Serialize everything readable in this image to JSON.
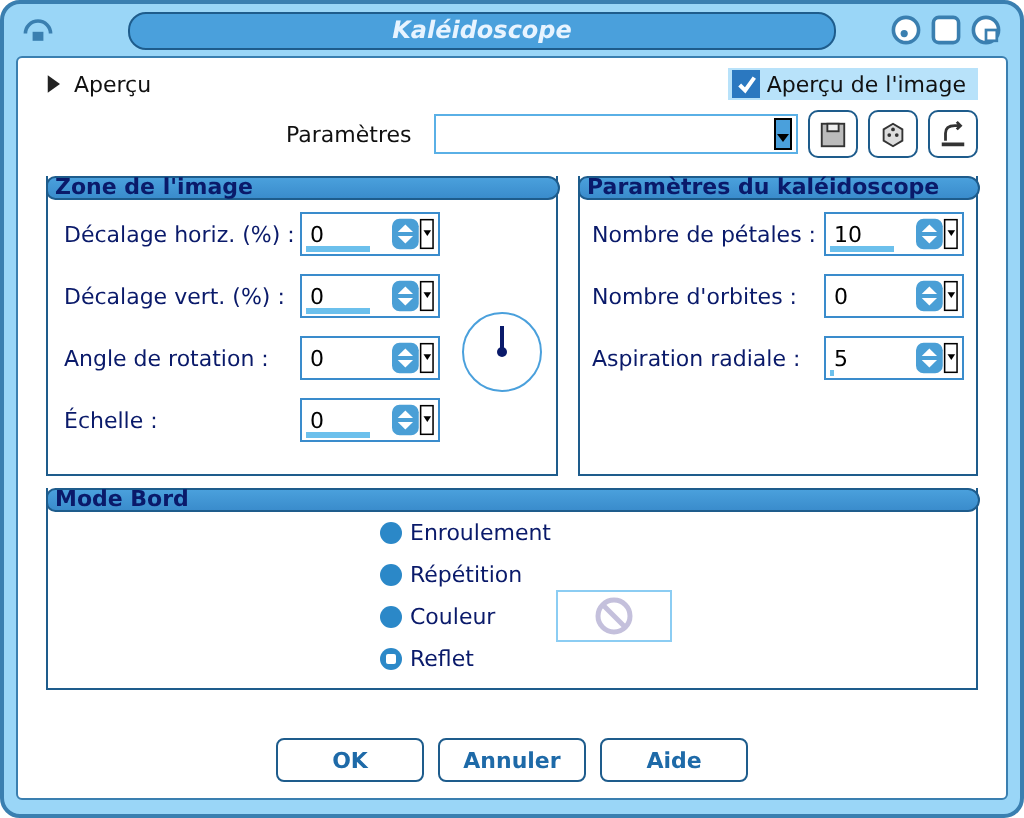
{
  "window": {
    "title": "Kaléidoscope"
  },
  "preview": {
    "label": "Aperçu",
    "expanded": false
  },
  "image_preview": {
    "label": "Aperçu de l'image",
    "checked": true
  },
  "presets": {
    "label": "Paramètres"
  },
  "zone": {
    "title": "Zone de l'image",
    "fields": [
      {
        "label": "Décalage horiz. (%) :",
        "value": "0",
        "level": 0.5
      },
      {
        "label": "Décalage vert. (%) :",
        "value": "0",
        "level": 0.5
      },
      {
        "label": "Angle de rotation :",
        "value": "0"
      },
      {
        "label": "Échelle :",
        "value": "0",
        "level": 0.5
      }
    ]
  },
  "kaleido": {
    "title": "Paramètres du kaléidoscope",
    "fields": [
      {
        "label": "Nombre de pétales :",
        "value": "10",
        "level": 0.5
      },
      {
        "label": "Nombre d'orbites :",
        "value": "0"
      },
      {
        "label": "Aspiration radiale :",
        "value": "5",
        "level": 0.03
      }
    ]
  },
  "edge_mode": {
    "title": "Mode Bord",
    "options": [
      {
        "label": "Enroulement",
        "selected": false
      },
      {
        "label": "Répétition",
        "selected": false
      },
      {
        "label": "Couleur",
        "selected": false
      },
      {
        "label": "Reflet",
        "selected": true
      }
    ]
  },
  "buttons": [
    "OK",
    "Annuler",
    "Aide"
  ]
}
